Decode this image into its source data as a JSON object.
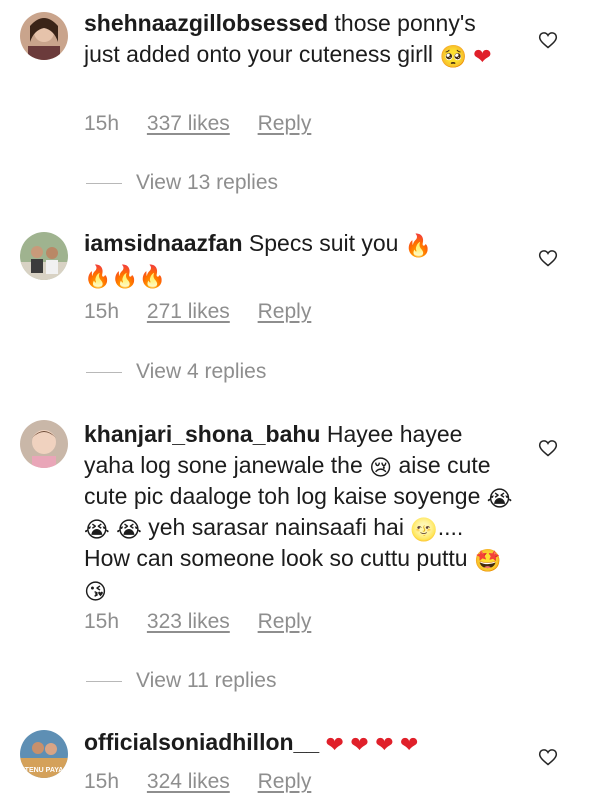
{
  "comments": [
    {
      "username": "shehnaazgillobsessed",
      "text": " those ponny's just added onto your cuteness girll ",
      "emojis": [
        "🥺",
        "❤"
      ],
      "time": "15h",
      "likes": "337 likes",
      "reply": "Reply",
      "view_replies": "View 13 replies"
    },
    {
      "username": "iamsidnaazfan",
      "text": " Specs suit you ",
      "emojis": [
        "🔥",
        "🔥",
        "🔥",
        "🔥"
      ],
      "time": "15h",
      "likes": "271 likes",
      "reply": "Reply",
      "view_replies": "View 4 replies"
    },
    {
      "username": "khanjari_shona_bahu",
      "text_1": " Hayee hayee yaha log sone janewale the ",
      "text_2": " aise cute cute pic daaloge toh log kaise soyenge ",
      "text_3": " yeh sarasar nainsaafi hai ",
      "text_4": ".... How can someone look so cuttu puttu ",
      "emojis": [
        "😢",
        "😭",
        "😭",
        "😭",
        "🌝",
        "🤩",
        "😘"
      ],
      "time": "15h",
      "likes": "323 likes",
      "reply": "Reply",
      "view_replies": "View 11 replies"
    },
    {
      "username": "officialsoniadhillon__",
      "text": " ",
      "emojis": [
        "❤",
        "❤",
        "❤",
        "❤"
      ],
      "avatar_text": "TENU PAYA",
      "time": "15h",
      "likes": "324 likes",
      "reply": "Reply"
    }
  ],
  "colors": {
    "text": "#1c1c1c",
    "meta": "#8e8e8e",
    "heart": "#e0202a",
    "fire": "#f26522"
  }
}
